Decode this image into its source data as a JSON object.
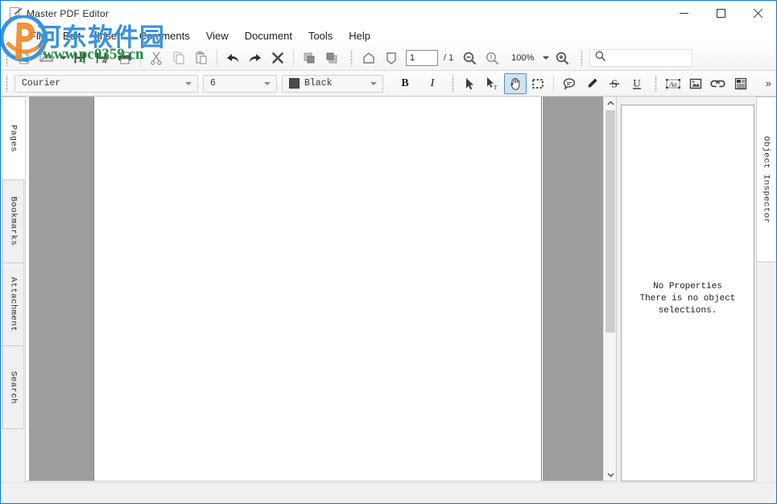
{
  "window": {
    "title": "Master PDF Editor",
    "icon": "document-pen-icon",
    "minimize_label": "–",
    "maximize_label": "□",
    "close_label": "✕"
  },
  "menu": {
    "items": [
      {
        "label": "File"
      },
      {
        "label": "Edit"
      },
      {
        "label": "Insert"
      },
      {
        "label": "Comments"
      },
      {
        "label": "View"
      },
      {
        "label": "Document"
      },
      {
        "label": "Tools"
      },
      {
        "label": "Help"
      }
    ]
  },
  "toolbar_main": {
    "buttons": [
      {
        "name": "new-document-button",
        "icon": "new-document-icon",
        "tooltip": "New"
      },
      {
        "name": "open-document-button",
        "icon": "open-folder-icon",
        "tooltip": "Open"
      },
      {
        "name": "open-dropdown-button",
        "icon": "chevron-down-icon",
        "tooltip": "Open recent"
      },
      {
        "name": "save-button",
        "icon": "floppy-disk-icon",
        "tooltip": "Save"
      },
      {
        "name": "save-as-button",
        "icon": "floppy-disk-pen-icon",
        "tooltip": "Save As"
      },
      {
        "name": "print-button",
        "icon": "printer-icon",
        "tooltip": "Print"
      },
      {
        "name": "cut-button",
        "icon": "scissors-icon",
        "tooltip": "Cut"
      },
      {
        "name": "copy-button",
        "icon": "copy-pages-icon",
        "tooltip": "Copy"
      },
      {
        "name": "paste-button",
        "icon": "clipboard-icon",
        "tooltip": "Paste"
      },
      {
        "name": "undo-button",
        "icon": "undo-arrow-icon",
        "tooltip": "Undo"
      },
      {
        "name": "redo-button",
        "icon": "redo-arrow-icon",
        "tooltip": "Redo"
      },
      {
        "name": "delete-button",
        "icon": "x-cross-icon",
        "tooltip": "Delete"
      },
      {
        "name": "bring-forward-button",
        "icon": "bring-forward-icon",
        "tooltip": "Bring Forward"
      },
      {
        "name": "send-backward-button",
        "icon": "send-backward-icon",
        "tooltip": "Send Backward"
      },
      {
        "name": "fit-page-button",
        "icon": "fit-page-icon",
        "tooltip": "Fit Page"
      },
      {
        "name": "fit-width-button",
        "icon": "fit-width-icon",
        "tooltip": "Fit Width"
      }
    ],
    "page_number": "1",
    "page_total": "/ 1",
    "zoom_out_icon": "zoom-out-icon",
    "zoom_reset_icon": "zoom-actual-size-icon",
    "zoom_value": "100%",
    "zoom_dropdown_icon": "chevron-down-icon",
    "zoom_in_icon": "zoom-in-icon",
    "search_icon": "search-icon",
    "search_value": "",
    "search_placeholder": ""
  },
  "toolbar_format": {
    "font_family": "Courier",
    "font_size": "6",
    "font_color_label": "Black",
    "font_color_hex": "#4b4b4b",
    "bold_label": "B",
    "italic_label": "I",
    "tools": [
      {
        "name": "select-tool",
        "icon": "cursor-arrow-icon",
        "active": false
      },
      {
        "name": "edit-text-tool",
        "icon": "cursor-text-icon",
        "active": false
      },
      {
        "name": "hand-tool",
        "icon": "hand-icon",
        "active": true
      },
      {
        "name": "marquee-select-tool",
        "icon": "dashed-rectangle-icon",
        "active": false
      },
      {
        "name": "add-comment-tool",
        "icon": "speech-bubble-icon",
        "active": false
      },
      {
        "name": "highlight-tool",
        "icon": "pencil-icon",
        "active": false
      },
      {
        "name": "strikeout-tool",
        "icon": "strikethrough-s-icon",
        "active": false
      },
      {
        "name": "underline-tool",
        "icon": "underline-u-icon",
        "active": false
      },
      {
        "name": "add-text-tool",
        "icon": "text-box-icon",
        "active": false
      },
      {
        "name": "add-image-tool",
        "icon": "image-frame-icon",
        "active": false
      },
      {
        "name": "add-link-tool",
        "icon": "chain-link-icon",
        "active": false
      },
      {
        "name": "form-field-tool",
        "icon": "form-list-icon",
        "active": false
      }
    ],
    "overflow_label": "»"
  },
  "sidebar_left": {
    "tabs": [
      {
        "label": "Pages",
        "selected": true
      },
      {
        "label": "Bookmarks",
        "selected": false
      },
      {
        "label": "Attachment",
        "selected": false
      },
      {
        "label": "Search",
        "selected": false
      }
    ]
  },
  "document": {
    "scrollbar": {
      "up_arrow_icon": "chevron-up-icon",
      "down_arrow_icon": "chevron-down-icon"
    }
  },
  "inspector": {
    "tab_label": "Object Inspector",
    "message_line1": "No Properties",
    "message_line2": "There is no object",
    "message_line3": "selections."
  },
  "watermark": {
    "chinese": "河东软件园",
    "url": "www.pc0359.cn",
    "logo_icon": "site-logo-icon",
    "blue": "#3a93dd",
    "green": "#1f8f3f",
    "orange": "#f08a2a"
  }
}
